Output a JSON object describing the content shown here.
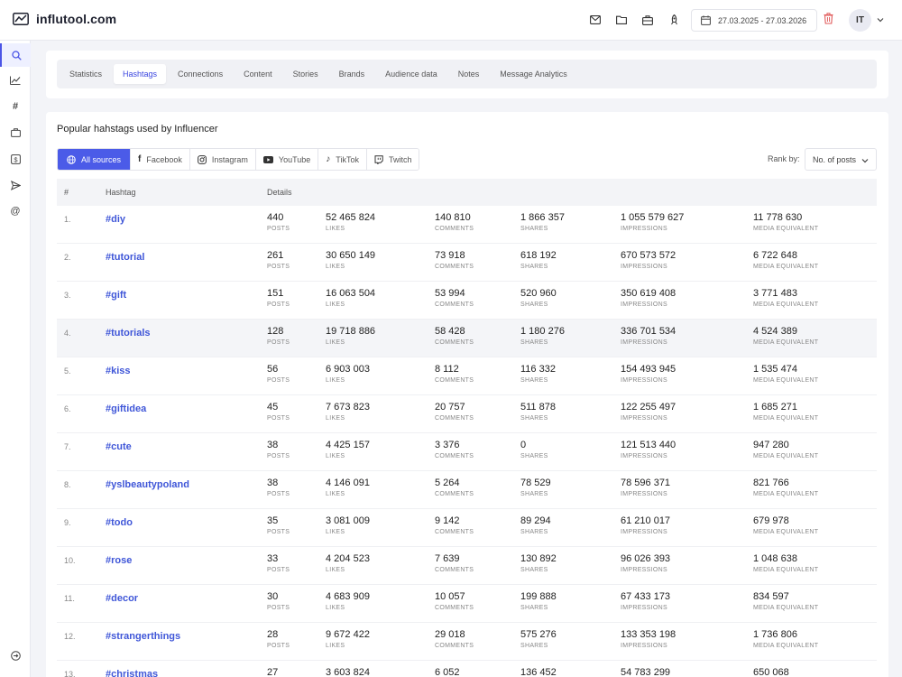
{
  "header": {
    "logo_text": "influtool.com",
    "icons": [
      "mail-icon",
      "folder-icon",
      "briefcase-icon",
      "rocket-icon"
    ],
    "date_range": "27.03.2025 - 27.03.2026",
    "avatar_initials": "IT"
  },
  "sidebar": {
    "items": [
      "search-icon",
      "chart-icon",
      "hashtag-icon",
      "briefcase-icon",
      "dollar-icon",
      "send-icon",
      "at-icon"
    ],
    "bottom": "logout-icon"
  },
  "tabs": [
    {
      "label": "Statistics"
    },
    {
      "label": "Hashtags",
      "active": true
    },
    {
      "label": "Connections"
    },
    {
      "label": "Content"
    },
    {
      "label": "Stories"
    },
    {
      "label": "Brands"
    },
    {
      "label": "Audience data"
    },
    {
      "label": "Notes"
    },
    {
      "label": "Message Analytics"
    }
  ],
  "main": {
    "title": "Popular hahstags used by Influencer",
    "sources": [
      "All sources",
      "Facebook",
      "Instagram",
      "YouTube",
      "TikTok",
      "Twitch"
    ],
    "rank_label": "Rank by:",
    "rank_value": "No. of posts"
  },
  "table": {
    "headers": {
      "num": "#",
      "hashtag": "Hashtag",
      "details": "Details"
    },
    "metric_labels": {
      "posts": "POSTS",
      "likes": "LIKES",
      "comments": "COMMENTS",
      "shares": "SHARES",
      "impressions": "IMPRESSIONS",
      "media": "MEDIA EQUIVALENT"
    },
    "rows": [
      {
        "n": "1.",
        "tag": "#diy",
        "posts": "440",
        "likes": "52 465 824",
        "comments": "140 810",
        "shares": "1 866 357",
        "impressions": "1 055 579 627",
        "media": "11 778 630"
      },
      {
        "n": "2.",
        "tag": "#tutorial",
        "posts": "261",
        "likes": "30 650 149",
        "comments": "73 918",
        "shares": "618 192",
        "impressions": "670 573 572",
        "media": "6 722 648"
      },
      {
        "n": "3.",
        "tag": "#gift",
        "posts": "151",
        "likes": "16 063 504",
        "comments": "53 994",
        "shares": "520 960",
        "impressions": "350 619 408",
        "media": "3 771 483"
      },
      {
        "n": "4.",
        "tag": "#tutorials",
        "posts": "128",
        "likes": "19 718 886",
        "comments": "58 428",
        "shares": "1 180 276",
        "impressions": "336 701 534",
        "media": "4 524 389"
      },
      {
        "n": "5.",
        "tag": "#kiss",
        "posts": "56",
        "likes": "6 903 003",
        "comments": "8 112",
        "shares": "116 332",
        "impressions": "154 493 945",
        "media": "1 535 474"
      },
      {
        "n": "6.",
        "tag": "#giftidea",
        "posts": "45",
        "likes": "7 673 823",
        "comments": "20 757",
        "shares": "511 878",
        "impressions": "122 255 497",
        "media": "1 685 271"
      },
      {
        "n": "7.",
        "tag": "#cute",
        "posts": "38",
        "likes": "4 425 157",
        "comments": "3 376",
        "shares": "0",
        "impressions": "121 513 440",
        "media": "947 280"
      },
      {
        "n": "8.",
        "tag": "#yslbeautypoland",
        "posts": "38",
        "likes": "4 146 091",
        "comments": "5 264",
        "shares": "78 529",
        "impressions": "78 596 371",
        "media": "821 766"
      },
      {
        "n": "9.",
        "tag": "#todo",
        "posts": "35",
        "likes": "3 081 009",
        "comments": "9 142",
        "shares": "89 294",
        "impressions": "61 210 017",
        "media": "679 978"
      },
      {
        "n": "10.",
        "tag": "#rose",
        "posts": "33",
        "likes": "4 204 523",
        "comments": "7 639",
        "shares": "130 892",
        "impressions": "96 026 393",
        "media": "1 048 638"
      },
      {
        "n": "11.",
        "tag": "#decor",
        "posts": "30",
        "likes": "4 683 909",
        "comments": "10 057",
        "shares": "199 888",
        "impressions": "67 433 173",
        "media": "834 597"
      },
      {
        "n": "12.",
        "tag": "#strangerthings",
        "posts": "28",
        "likes": "9 672 422",
        "comments": "29 018",
        "shares": "575 276",
        "impressions": "133 353 198",
        "media": "1 736 806"
      },
      {
        "n": "13.",
        "tag": "#christmas",
        "posts": "27",
        "likes": "3 603 824",
        "comments": "6 052",
        "shares": "136 452",
        "impressions": "54 783 299",
        "media": "650 068"
      }
    ]
  },
  "colors": {
    "accent": "#4b5be8",
    "link": "#3f56d8",
    "page_bg": "#f3f4f8"
  }
}
